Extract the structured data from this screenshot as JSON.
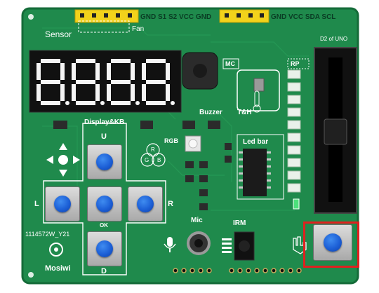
{
  "board": {
    "headers": {
      "left": "GND S1 S2 VCC GND",
      "right": "GND VCC SDA SCL"
    },
    "labels": {
      "sensor": "Sensor",
      "fan": "Fan",
      "d2_of_uno": "D2 of UNO",
      "mic_top": "MC",
      "rp": "RP",
      "buzzer": "Buzzer",
      "th": "T&H",
      "led_bar": "Led bar",
      "display_kb": "Display&KB",
      "rgb": "RGB",
      "r_color": "R",
      "g_color": "G",
      "b_color": "B",
      "key_u": "U",
      "key_l": "L",
      "key_r": "R",
      "key_ok": "OK",
      "key_d": "D",
      "mic": "Mic",
      "irm": "IRM",
      "part_number": "1114572W_Y21",
      "brand": "Mosiwi"
    },
    "display_digits": "8.8.8.8."
  },
  "colors": {
    "pcb": "#1f8a4c",
    "pcb_edge": "#146b38",
    "header_yellow": "#f2d21b",
    "button_blue": "#1c5fd6",
    "highlight_box": "#e0201f"
  }
}
